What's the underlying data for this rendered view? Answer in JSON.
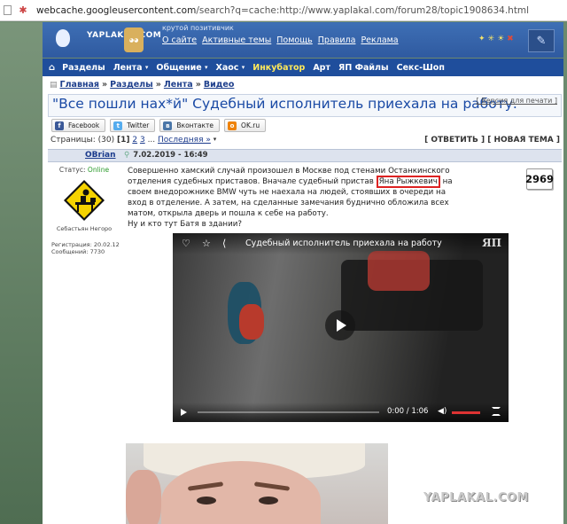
{
  "browser": {
    "url_prefix": "webcache.googleusercontent.com",
    "url_rest": "/search?q=cache:http://www.yaplakal.com/forum28/topic1908634.html"
  },
  "header": {
    "logo_text": "YAPLAKAL.COM",
    "slogan": "крутой позитивчик",
    "links": [
      "О сайте",
      "Активные темы",
      "Помощь",
      "Правила",
      "Реклама"
    ]
  },
  "nav": {
    "items": [
      {
        "label": "Разделы",
        "caret": ""
      },
      {
        "label": "Лента",
        "caret": "▾"
      },
      {
        "label": "Общение",
        "caret": "▾"
      },
      {
        "label": "Хаос",
        "caret": "▾"
      },
      {
        "label": "Инкубатор",
        "caret": ""
      },
      {
        "label": "Арт",
        "caret": ""
      },
      {
        "label": "ЯП Файлы",
        "caret": ""
      },
      {
        "label": "Секс-Шоп",
        "caret": ""
      }
    ],
    "highlight_color": "#ffe95a"
  },
  "breadcrumb": [
    "Главная",
    "Разделы",
    "Лента",
    "Видео"
  ],
  "topic": {
    "title": "\"Все пошли нах*й\" Судебный исполнитель приехала на работу.",
    "print_label": "[ Версия для печати ]"
  },
  "share": [
    {
      "label": "Facebook",
      "icon": "f",
      "color": "#3b5998"
    },
    {
      "label": "Twitter",
      "icon": "t",
      "color": "#55acee"
    },
    {
      "label": "Вконтакте",
      "icon": "в",
      "color": "#4a76a8"
    },
    {
      "label": "OK.ru",
      "icon": "о",
      "color": "#ee8208"
    }
  ],
  "pagination": {
    "prefix": "Страницы: (30)",
    "current": "[1]",
    "p2": "2",
    "p3": "3",
    "ellipsis": "...",
    "last": "Последняя »",
    "last_suffix": "▾",
    "reply": "[ ОТВЕТИТЬ ]",
    "new_topic": "[ НОВАЯ ТЕМА ]"
  },
  "post": {
    "author": "OBrian",
    "date": "7.02.2019 - 16:49",
    "status_label": "Статус:",
    "status_value": "Online",
    "nick_caption": "Себастьян Негоро",
    "reg_line": "Регистрация: 20.02.12",
    "msg_line": "Сообщений: 7730",
    "text_before": "Совершенно хамский случай произошел в Москве под стенами Останкинского отделения судебных приставов. Вначале судебный пристав ",
    "highlighted_name": "Яна Рыжкевич",
    "text_after": " на своем внедорожнике BMW чуть не наехала на людей, стоявших в очереди на вход в отделение. А затем, на сделанные замечания буднично обложила всех матом, открыла дверь и пошла к себе на работу.",
    "question": "Ну и кто тут Батя в здании?",
    "rating": "2969"
  },
  "video": {
    "title": "Судебный исполнитель приехала на работу",
    "logo": "ЯП",
    "time_current": "0:00",
    "time_total": "1:06"
  },
  "watermark": "YAPLAKAL.COM"
}
